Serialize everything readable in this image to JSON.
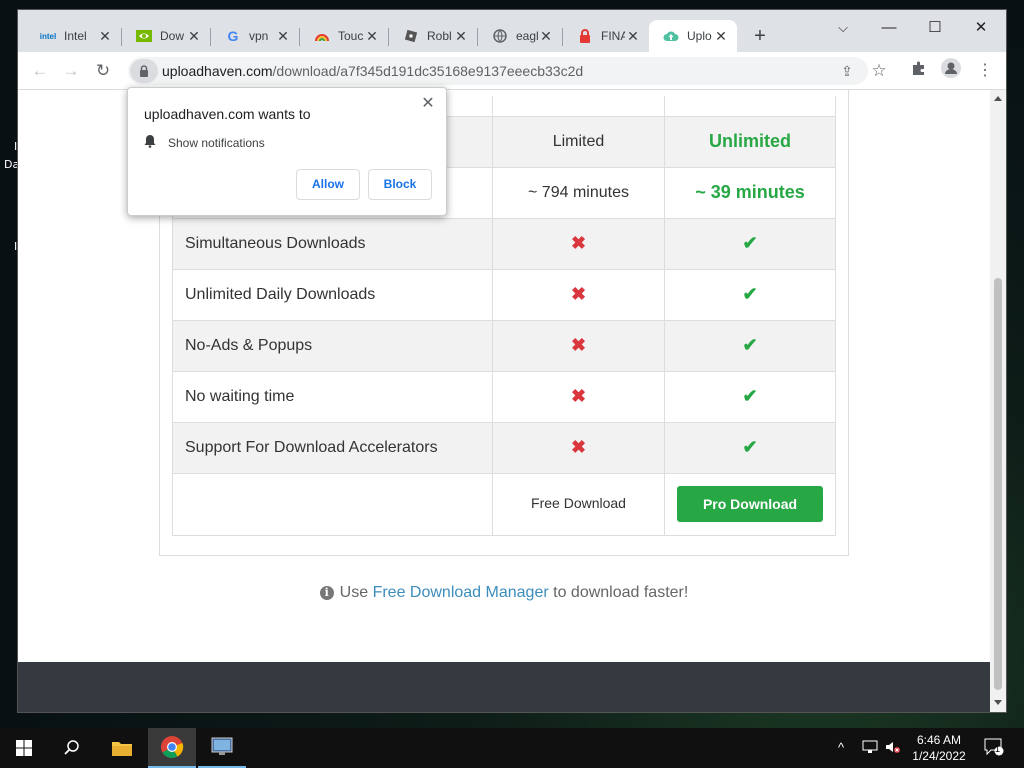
{
  "desktop": {
    "fragments": [
      "I",
      "Da",
      "I"
    ]
  },
  "browser": {
    "tabs": [
      {
        "label": "Intel",
        "icon": "intel-icon"
      },
      {
        "label": "Dow",
        "icon": "nvidia-icon"
      },
      {
        "label": "vpn",
        "icon": "google-icon"
      },
      {
        "label": "Touc",
        "icon": "rainbow-icon"
      },
      {
        "label": "Robl",
        "icon": "roblox-icon"
      },
      {
        "label": "eagl",
        "icon": "globe-icon"
      },
      {
        "label": "FINA",
        "icon": "lock-red-icon"
      },
      {
        "label": "Uplo",
        "icon": "uploadhaven-icon"
      }
    ],
    "new_tab": "+",
    "url_host": "uploadhaven.com",
    "url_path": "/download/a7f345d191dc35168e9137eeecb33c2d"
  },
  "notification": {
    "title": "uploadhaven.com wants to",
    "permission": "Show notifications",
    "allow": "Allow",
    "block": "Block"
  },
  "comparison": {
    "header": {
      "limited": "Limited",
      "unlimited": "Unlimited"
    },
    "speed": {
      "limited": "~ 794 minutes",
      "unlimited": "~ 39 minutes"
    },
    "features": [
      "Simultaneous Downloads",
      "Unlimited Daily Downloads",
      "No-Ads & Popups",
      "No waiting time",
      "Support For Download Accelerators"
    ],
    "free_download": "Free Download",
    "pro_download": "Pro Download",
    "x_mark": "✖",
    "check_mark": "✔"
  },
  "fdm_note": {
    "prefix": "Use",
    "link": "Free Download Manager",
    "suffix": "to download faster!"
  },
  "taskbar": {
    "time": "6:46 AM",
    "date": "1/24/2022",
    "notification_count": "1"
  },
  "colors": {
    "green": "#28a745",
    "red": "#d9363e",
    "link": "#3c8dbc",
    "footer": "#343a40"
  }
}
